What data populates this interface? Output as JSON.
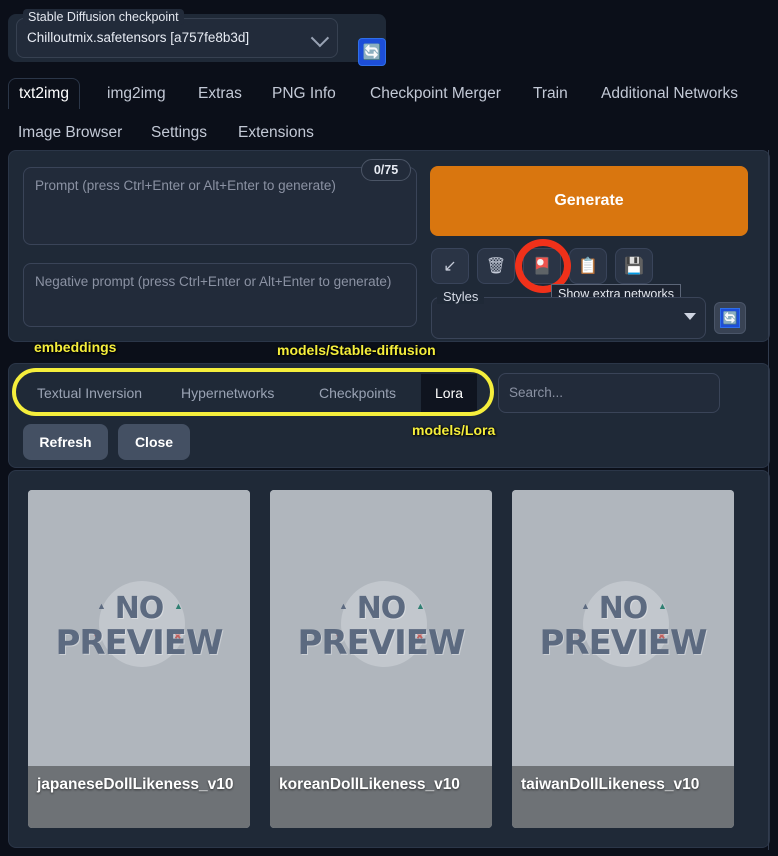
{
  "checkpoint": {
    "label": "Stable Diffusion checkpoint",
    "value": "Chilloutmix.safetensors [a757fe8b3d]",
    "refresh_icon": "reload-icon",
    "caret_icon": "chevron-down-icon"
  },
  "tabs": {
    "row1": [
      {
        "label": "txt2img",
        "active": true
      },
      {
        "label": "img2img",
        "active": false
      },
      {
        "label": "Extras",
        "active": false
      },
      {
        "label": "PNG Info",
        "active": false
      },
      {
        "label": "Checkpoint Merger",
        "active": false
      },
      {
        "label": "Train",
        "active": false
      },
      {
        "label": "Additional Networks",
        "active": false
      }
    ],
    "row2": [
      {
        "label": "Image Browser",
        "active": false
      },
      {
        "label": "Settings",
        "active": false
      },
      {
        "label": "Extensions",
        "active": false
      }
    ]
  },
  "prompt": {
    "placeholder": "Prompt (press Ctrl+Enter or Alt+Enter to generate)",
    "value": "",
    "token_counter": "0/75"
  },
  "negative_prompt": {
    "placeholder": "Negative prompt (press Ctrl+Enter or Alt+Enter to generate)",
    "value": ""
  },
  "generate": {
    "label": "Generate",
    "color": "#d9760f"
  },
  "toolbar": {
    "buttons": [
      {
        "icon": "arrow-down-left-icon",
        "glyph": "↙"
      },
      {
        "icon": "trash-icon",
        "glyph": "🗑"
      },
      {
        "icon": "extra-networks-card-icon",
        "glyph": "🎴"
      },
      {
        "icon": "clipboard-icon",
        "glyph": "📋"
      },
      {
        "icon": "floppy-save-icon",
        "glyph": "💾"
      }
    ],
    "tooltip": "Show extra networks",
    "highlight_color": "#f0311a"
  },
  "styles": {
    "label": "Styles",
    "value": "",
    "caret_icon": "caret-down-icon",
    "refresh_icon": "reload-icon"
  },
  "extra_networks": {
    "tabs": [
      {
        "label": "Textual Inversion",
        "active": false
      },
      {
        "label": "Hypernetworks",
        "active": false
      },
      {
        "label": "Checkpoints",
        "active": false
      },
      {
        "label": "Lora",
        "active": true
      }
    ],
    "search": {
      "placeholder": "Search...",
      "value": ""
    },
    "refresh_label": "Refresh",
    "close_label": "Close"
  },
  "annotations": {
    "color": "#f5ee3c",
    "items": [
      {
        "text": "embeddings"
      },
      {
        "text": "models/Stable-diffusion"
      },
      {
        "text": "models/Lora"
      }
    ]
  },
  "cards": [
    {
      "name": "japaneseDollLikeness_v10",
      "preview_line1": "NO",
      "preview_line2": "PREVIEW"
    },
    {
      "name": "koreanDollLikeness_v10",
      "preview_line1": "NO",
      "preview_line2": "PREVIEW"
    },
    {
      "name": "taiwanDollLikeness_v10",
      "preview_line1": "NO",
      "preview_line2": "PREVIEW"
    }
  ]
}
